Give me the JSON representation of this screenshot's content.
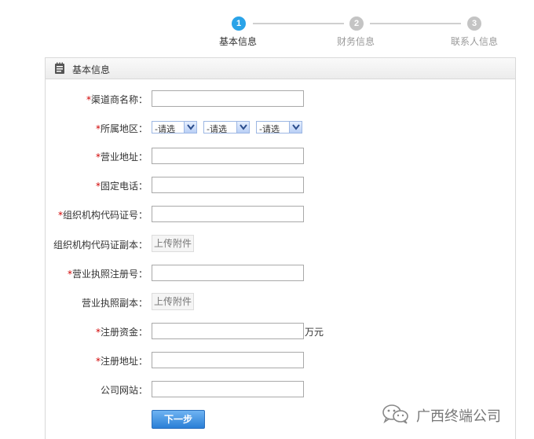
{
  "stepper": {
    "steps": [
      {
        "number": "1",
        "label": "基本信息",
        "state": "active"
      },
      {
        "number": "2",
        "label": "财务信息",
        "state": "inactive"
      },
      {
        "number": "3",
        "label": "联系人信息",
        "state": "inactive"
      }
    ],
    "active_color": "#2aa3e8",
    "inactive_color": "#c4c4c4"
  },
  "panel": {
    "title": "基本信息",
    "icon": "notebook-icon"
  },
  "form": {
    "required_mark": "*",
    "fields": {
      "channel_name": {
        "label": "渠道商名称：",
        "value": ""
      },
      "region": {
        "label": "所属地区：",
        "province": "-请选",
        "city": "-请选",
        "district": "-请选"
      },
      "business_address": {
        "label": "营业地址：",
        "value": ""
      },
      "landline": {
        "label": "固定电话：",
        "value": ""
      },
      "org_code": {
        "label": "组织机构代码证号：",
        "value": ""
      },
      "org_code_copy": {
        "label": "组织机构代码证副本：",
        "button": "上传附件"
      },
      "license_no": {
        "label": "营业执照注册号：",
        "value": ""
      },
      "license_copy": {
        "label": "营业执照副本：",
        "button": "上传附件"
      },
      "registered_capital": {
        "label": "注册资金：",
        "value": "",
        "unit": "万元"
      },
      "registered_address": {
        "label": "注册地址：",
        "value": ""
      },
      "website": {
        "label": "公司网站：",
        "value": ""
      }
    },
    "next_button": "下一步",
    "button_color": "#2a7fd6"
  },
  "watermark": {
    "icon": "wechat-icon",
    "text": "广西终端公司"
  }
}
